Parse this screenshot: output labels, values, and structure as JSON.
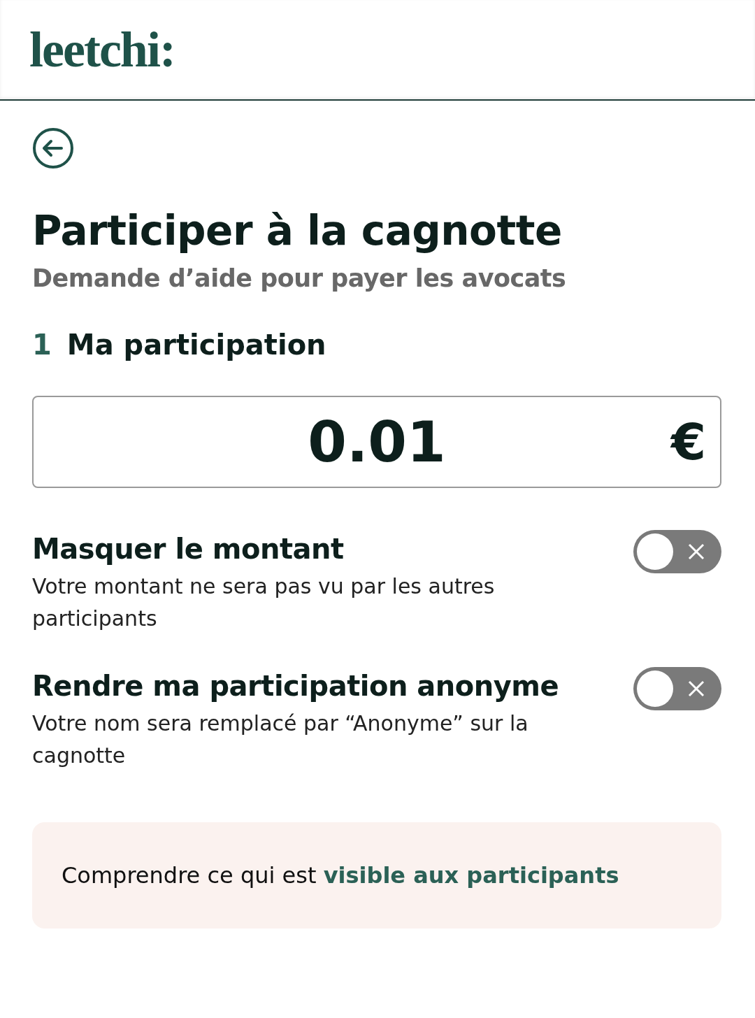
{
  "header": {
    "logo": "leetchi:"
  },
  "title": "Participer à la cagnotte",
  "subtitle": "Demande d’aide pour payer les avocats",
  "step": {
    "number": "1",
    "label": "Ma participation"
  },
  "amount": {
    "value": "0.01",
    "currency": "€"
  },
  "options": [
    {
      "title": "Masquer le montant",
      "description": "Votre montant ne sera pas vu par les autres participants",
      "on": false
    },
    {
      "title": "Rendre ma participation anonyme",
      "description": "Votre nom sera remplacé par “Anonyme” sur la cagnotte",
      "on": false
    }
  ],
  "info": {
    "text": "Comprendre ce qui est ",
    "link": "visible aux participants"
  }
}
